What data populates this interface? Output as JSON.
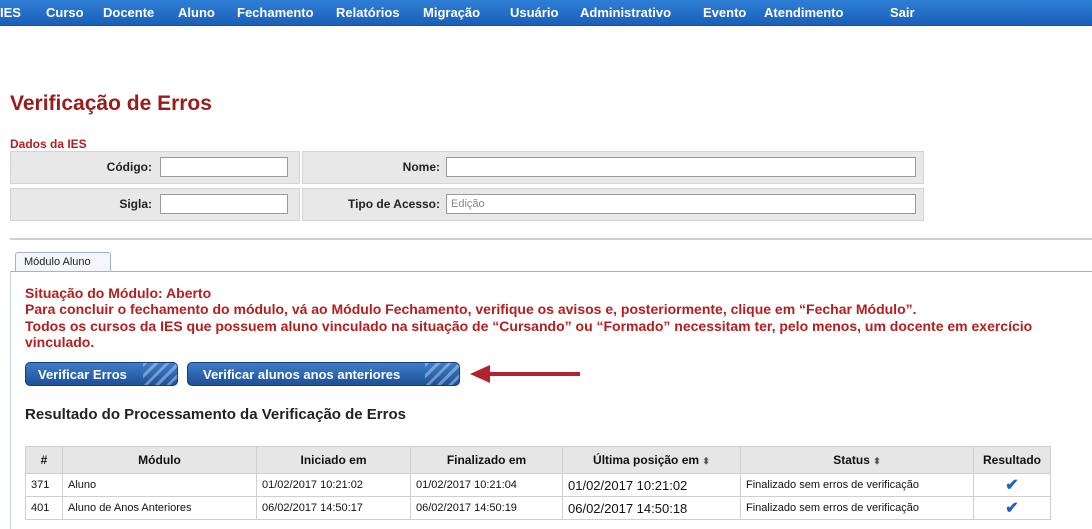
{
  "nav": {
    "items": [
      "IES",
      "Curso",
      "Docente",
      "Aluno",
      "Fechamento",
      "Relatórios",
      "Migração",
      "Usuário",
      "Administrativo",
      "Evento",
      "Atendimento",
      "Sair"
    ]
  },
  "page": {
    "title": "Verificação de Erros"
  },
  "ies": {
    "section_label": "Dados da IES",
    "codigo_label": "Código:",
    "codigo_value": "",
    "nome_label": "Nome:",
    "nome_value": "",
    "sigla_label": "Sigla:",
    "sigla_value": "",
    "tipo_label": "Tipo de Acesso:",
    "tipo_value": "Edição"
  },
  "tab": {
    "label": "Módulo Aluno"
  },
  "module": {
    "situacao": "Situação do Módulo: Aberto",
    "msg1": "Para concluir o fechamento do módulo, vá ao Módulo Fechamento, verifique os avisos e, posteriormente, clique em “Fechar Módulo”.",
    "msg2": "Todos os cursos da IES que possuem aluno vinculado na situação de “Cursando” ou “Formado” necessitam ter, pelo menos, um docente em exercício vinculado."
  },
  "buttons": {
    "verificar_erros": "Verificar Erros",
    "verificar_anteriores": "Verificar alunos anos anteriores"
  },
  "results": {
    "title": "Resultado do Processamento da Verificação de Erros",
    "columns": {
      "num": "#",
      "modulo": "Módulo",
      "iniciado": "Iniciado em",
      "finalizado": "Finalizado em",
      "ultima": "Última posição em",
      "status": "Status",
      "resultado": "Resultado"
    },
    "sort_glyph": "⬍",
    "check_glyph": "✔",
    "rows": [
      {
        "num": "371",
        "modulo": "Aluno",
        "iniciado": "01/02/2017 10:21:02",
        "finalizado": "01/02/2017 10:21:04",
        "ultima": "01/02/2017 10:21:02",
        "status": "Finalizado sem erros de verificação"
      },
      {
        "num": "401",
        "modulo": "Aluno de Anos Anteriores",
        "iniciado": "06/02/2017 14:50:17",
        "finalizado": "06/02/2017 14:50:19",
        "ultima": "06/02/2017 14:50:18",
        "status": "Finalizado sem erros de verificação"
      }
    ]
  },
  "colors": {
    "nav": "#1a5fb8",
    "title": "#9b1b1b",
    "warning": "#b41e1e",
    "button": "#1d5098",
    "arrow": "#b3222f",
    "check": "#1e63b8"
  }
}
